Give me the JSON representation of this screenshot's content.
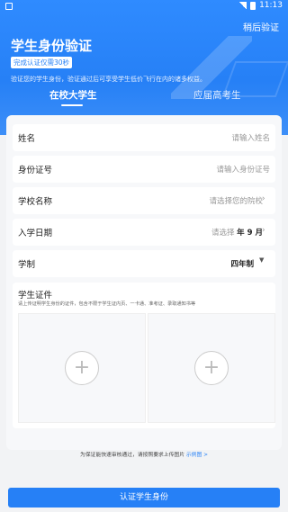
{
  "status": {
    "time": "11:13"
  },
  "header": {
    "later_label": "稍后验证",
    "title": "学生身份验证",
    "badge": "完成认证仅需30秒",
    "desc": "验证您的学生身份，验证通过后可享受学生低价飞行在内的诸多权益。"
  },
  "tabs": [
    {
      "label": "在校大学生",
      "active": true
    },
    {
      "label": "应届高考生",
      "active": false
    }
  ],
  "form": {
    "name": {
      "label": "姓名",
      "placeholder": "请输入姓名"
    },
    "id": {
      "label": "身份证号",
      "placeholder": "请输入身份证号"
    },
    "school": {
      "label": "学校名称",
      "placeholder": "请选择您的院校"
    },
    "enroll": {
      "label": "入学日期",
      "prefix": "请选择",
      "value": "年 9 月"
    },
    "system": {
      "label": "学制",
      "value": "四年制"
    }
  },
  "upload": {
    "label": "学生证件",
    "hint": "请上传证明学生身份的证件，包含不限于学生证内页、一卡通、准考证、录取通知书等"
  },
  "footer": {
    "note": "为保证能快速审核通过，请按照要求上传图片",
    "link": "示例图 >"
  },
  "submit_label": "认证学生身份",
  "colors": {
    "accent": "#2680f6"
  }
}
